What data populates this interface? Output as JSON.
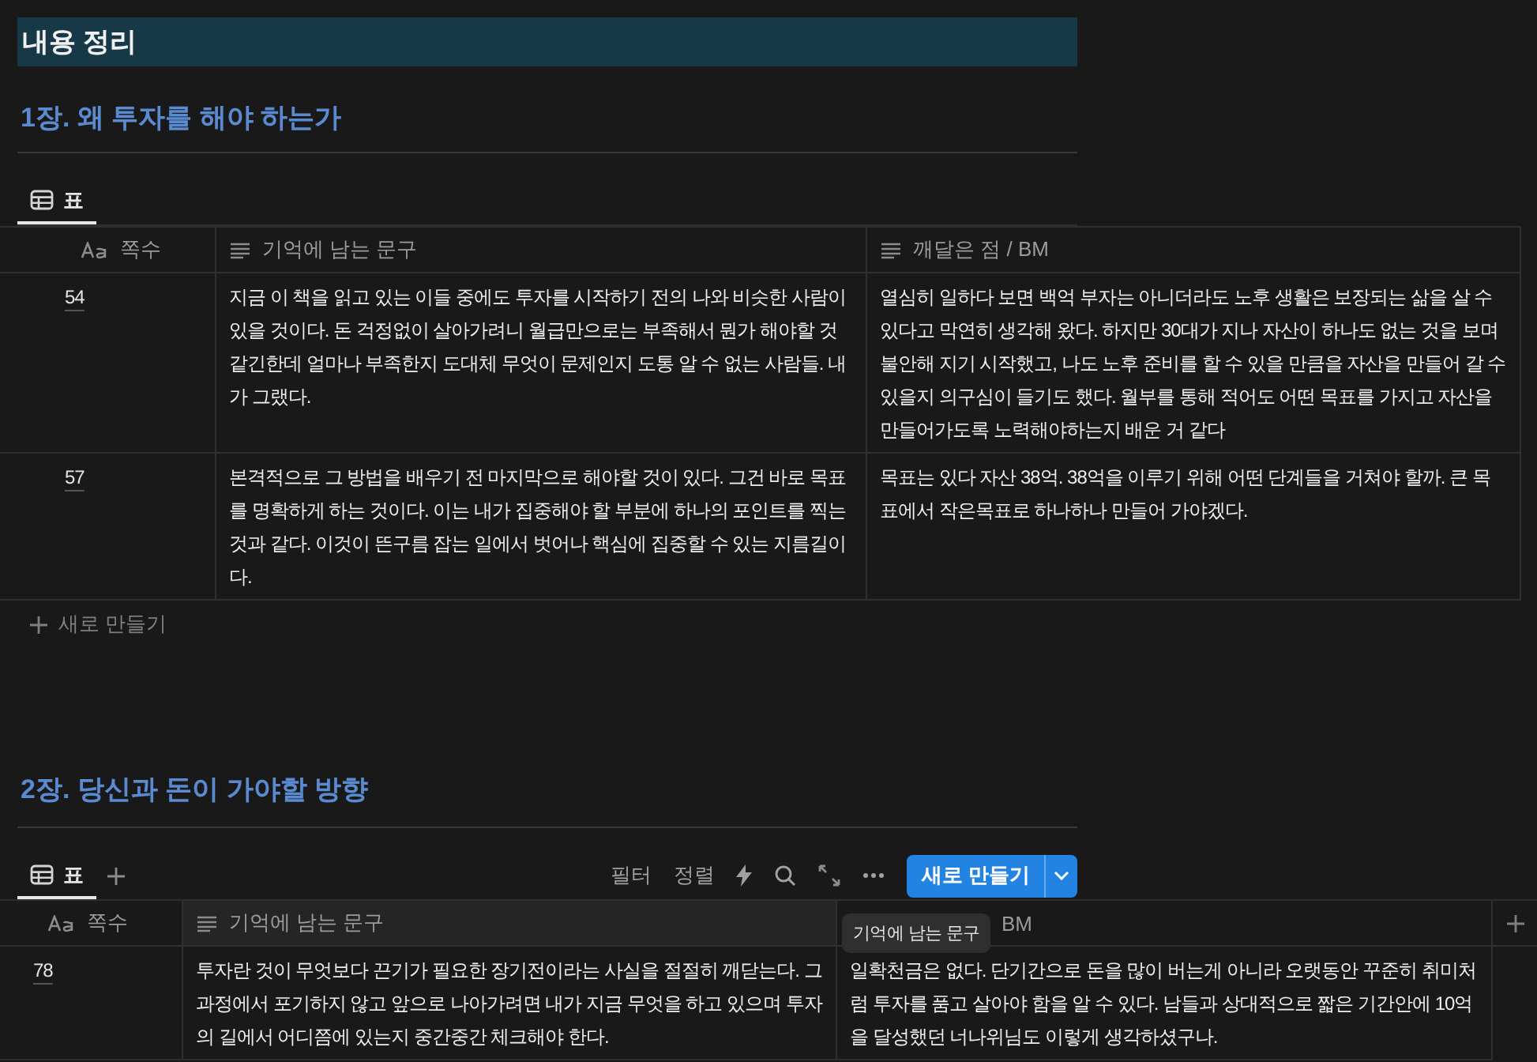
{
  "page_title": "내용 정리",
  "sections": [
    {
      "heading": "1장. 왜 투자를 해야 하는가",
      "tabs": [
        {
          "label": "표",
          "selected": true
        }
      ],
      "columns": [
        {
          "kind": "title",
          "label": "쪽수",
          "highlighted": false
        },
        {
          "kind": "text",
          "label": "기억에 남는 문구",
          "highlighted": false
        },
        {
          "kind": "text",
          "label": "깨달은 점 / BM",
          "highlighted": false
        }
      ],
      "rows": [
        {
          "page": "54",
          "quote": "지금 이 책을 읽고 있는 이들 중에도 투자를 시작하기 전의 나와 비슷한 사람이 있을 것이다. 돈 걱정없이 살아가려니 월급만으로는 부족해서 뭔가 해야할 것 같긴한데 얼마나 부족한지 도대체 무엇이 문제인지 도통 알 수 없는 사람들. 내가 그랬다.",
          "insight": "열심히 일하다 보면 백억 부자는 아니더라도 노후 생활은 보장되는 삶을 살 수 있다고 막연히 생각해 왔다. 하지만 30대가 지나 자산이 하나도 없는 것을 보며 불안해 지기 시작했고, 나도 노후 준비를 할 수 있을 만큼을 자산을 만들어 갈 수 있을지 의구심이 들기도 했다. 월부를 통해 적어도 어떤 목표를 가지고 자산을 만들어가도록 노력해야하는지 배운 거 같다"
        },
        {
          "page": "57",
          "quote": "본격적으로 그 방법을 배우기 전 마지막으로 해야할 것이 있다. 그건 바로 목표를 명확하게 하는 것이다. 이는 내가 집중해야 할 부분에 하나의 포인트를 찍는 것과 같다. 이것이 뜬구름 잡는 일에서 벗어나 핵심에 집중할 수 있는 지름길이다.",
          "insight": "목표는 있다 자산 38억. 38억을 이루기 위해 어떤 단계들을 거쳐야 할까. 큰 목표에서 작은목표로 하나하나 만들어 가야겠다."
        }
      ],
      "new_row": "새로 만들기"
    },
    {
      "heading": "2장. 당신과 돈이 가야할 방향",
      "tabs": [
        {
          "label": "표",
          "selected": true
        }
      ],
      "toolbar": {
        "filter": "필터",
        "sort": "정렬",
        "new_button": "새로 만들기"
      },
      "columns": [
        {
          "kind": "title",
          "label": "쪽수",
          "highlighted": false
        },
        {
          "kind": "text",
          "label": "기억에 남는 문구",
          "highlighted": true
        },
        {
          "kind": "partial",
          "label": "BM",
          "highlighted": false
        }
      ],
      "rows": [
        {
          "page": "78",
          "quote": "투자란 것이 무엇보다 끈기가 필요한 장기전이라는 사실을 절절히 깨닫는다. 그 과정에서 포기하지 않고 앞으로 나아가려면 내가 지금 무엇을 하고 있으며 투자의 길에서 어디쯤에 있는지 중간중간 체크해야 한다.",
          "insight": "일확천금은 없다. 단기간으로 돈을 많이 버는게 아니라 오랫동안 꾸준히 취미처럼 투자를 품고 살아야 함을 알 수 있다. 남들과 상대적으로 짧은 기간안에 10억을 달성했던 너나위님도 이렇게 생각하셨구나."
        }
      ],
      "tooltip": "기억에 남는 문구"
    }
  ]
}
